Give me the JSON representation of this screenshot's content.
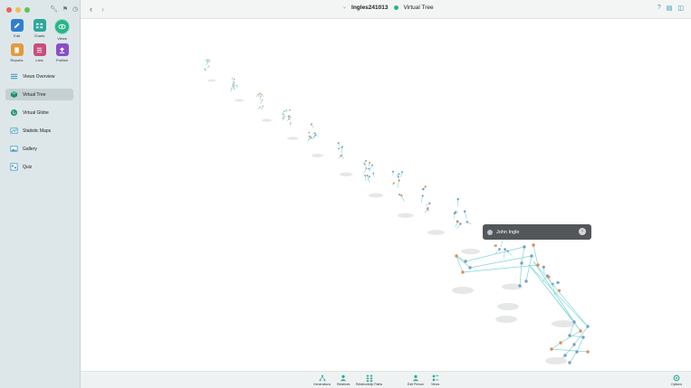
{
  "window": {
    "file_name": "Ingles241013",
    "view_name": "Virtual Tree"
  },
  "sidebar": {
    "apps": [
      {
        "label": "Edit",
        "color": "#2f7fd0",
        "icon": "pencil-icon"
      },
      {
        "label": "Charts",
        "color": "#2aa89a",
        "icon": "charts-icon"
      },
      {
        "label": "Views",
        "color": "#2bb389",
        "icon": "eye-icon"
      },
      {
        "label": "Reports",
        "color": "#e59a3a",
        "icon": "document-icon"
      },
      {
        "label": "Lists",
        "color": "#c84d7f",
        "icon": "list-icon"
      },
      {
        "label": "Publish",
        "color": "#8a4fc4",
        "icon": "upload-icon"
      }
    ],
    "nav": [
      {
        "label": "Views Overview",
        "icon": "list-icon",
        "active": false
      },
      {
        "label": "Virtual Tree",
        "icon": "tree-cube-icon",
        "active": true
      },
      {
        "label": "Virtual Globe",
        "icon": "globe-icon",
        "active": false
      },
      {
        "label": "Statistic Maps",
        "icon": "map-icon",
        "active": false
      },
      {
        "label": "Gallery",
        "icon": "gallery-icon",
        "active": false
      },
      {
        "label": "Quiz",
        "icon": "quiz-icon",
        "active": false
      }
    ]
  },
  "popup": {
    "person_name": "John Ingle"
  },
  "bottom_toolbar": {
    "items": [
      {
        "label": "Generations",
        "icon": "generations-icon"
      },
      {
        "label": "Relatives",
        "icon": "relatives-icon"
      },
      {
        "label": "Relationship Paths",
        "icon": "relationship-paths-icon"
      },
      {
        "label": "Edit Person",
        "icon": "edit-person-icon"
      },
      {
        "label": "Views",
        "icon": "views-icon"
      }
    ],
    "options_label": "Options"
  },
  "colors": {
    "accent": "#2bb389",
    "link_line": "#7fd6d6",
    "female_node": "#e58a4a",
    "male_node": "#7aa0c8"
  }
}
